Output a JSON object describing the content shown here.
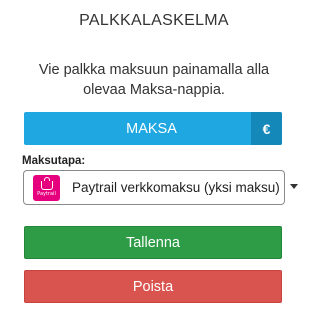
{
  "page": {
    "title": "PALKKALASKELMA",
    "instructions_line1": "Vie palkka maksuun painamalla alla",
    "instructions_line2": "olevaa Maksa-nappia."
  },
  "pay_button": {
    "label": "MAKSA",
    "currency_symbol": "€",
    "icon": "euro-icon",
    "color": "#1ea7e1",
    "icon_bg_color": "#1588ba"
  },
  "payment_method": {
    "label": "Maksutapa:",
    "selected_value": "Paytrail verkkomaksu (yksi maksu)",
    "logo_icon": "paytrail-logo",
    "logo_text": "Paytrail",
    "logo_color": "#e6007e"
  },
  "actions": {
    "save_label": "Tallenna",
    "save_color": "#2e9c46",
    "delete_label": "Poista",
    "delete_color": "#d9534f"
  }
}
